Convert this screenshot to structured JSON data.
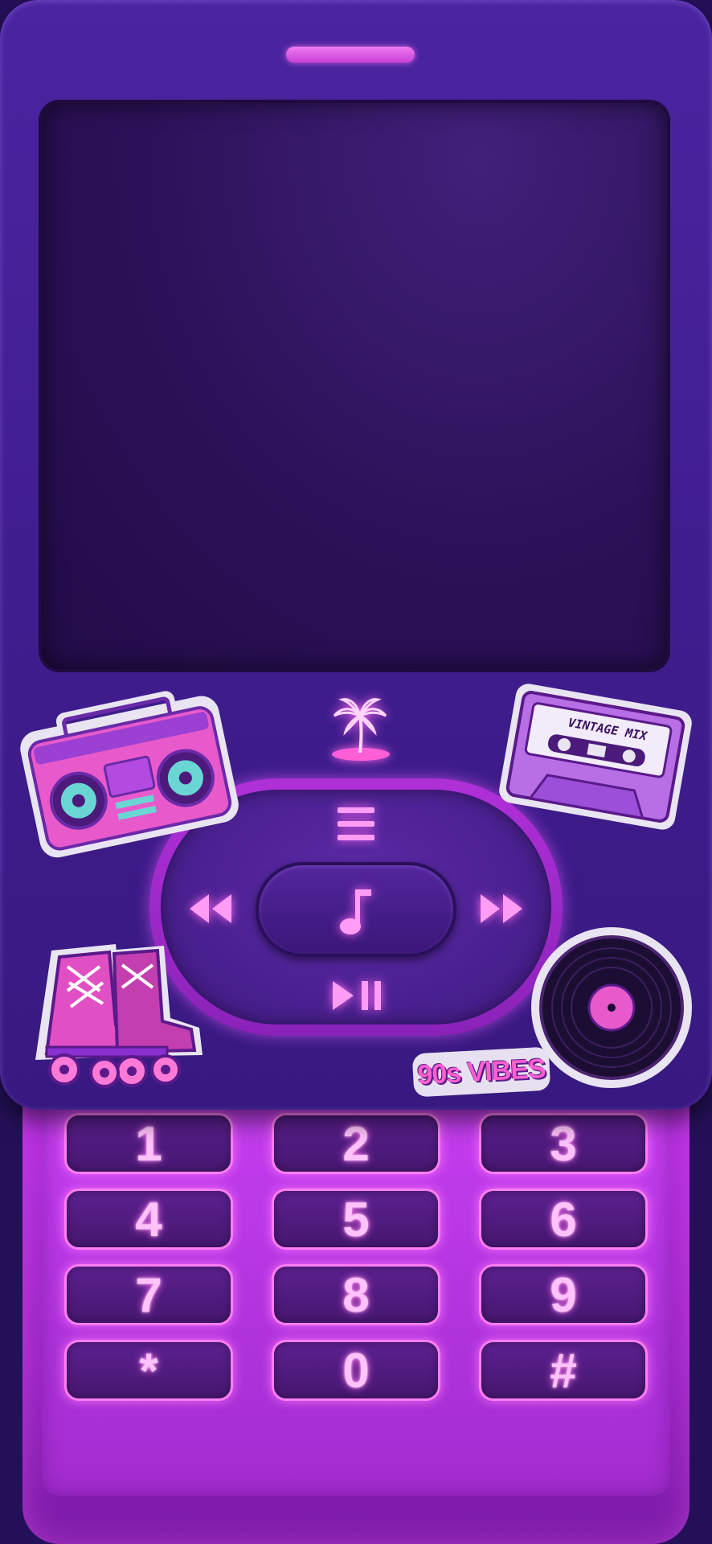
{
  "keypad": {
    "keys": [
      "1",
      "2",
      "3",
      "4",
      "5",
      "6",
      "7",
      "8",
      "9",
      "*",
      "0",
      "#"
    ]
  },
  "stickers": {
    "cassette_label": "VINTAGE MIX",
    "badge_text": "90s VIBES"
  },
  "colors": {
    "body": "#3f1d8e",
    "screen": "#2c1158",
    "neon_pink": "#ff7df2",
    "slider": "#b52ee0"
  },
  "icons": [
    "palm-tree-island-icon",
    "menu-icon",
    "rewind-icon",
    "music-note-icon",
    "fast-forward-icon",
    "play-pause-icon"
  ]
}
